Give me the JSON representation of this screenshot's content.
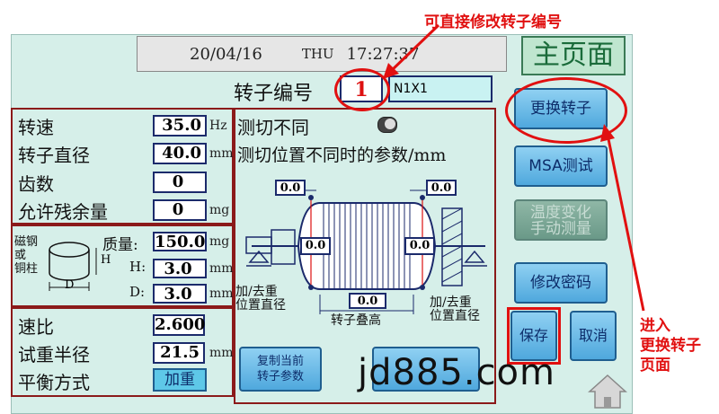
{
  "header": {
    "date": "20/04/16",
    "weekday": "THU",
    "time": "17:27:37",
    "page_title": "主页面"
  },
  "rotor": {
    "number_label": "转子编号",
    "number_value": "1",
    "name_value": "N1X1"
  },
  "params": {
    "speed": {
      "label": "转速",
      "value": "35.0",
      "unit": "Hz"
    },
    "diameter": {
      "label": "转子直径",
      "value": "40.0",
      "unit": "mm"
    },
    "teeth": {
      "label": "齿数",
      "value": "0"
    },
    "residual": {
      "label": "允许残余量",
      "value": "0",
      "unit": "mg"
    }
  },
  "weight": {
    "material_label_1": "磁钢",
    "material_label_2": "或",
    "material_label_3": "铜柱",
    "mass_label": "质量:",
    "mass_value": "150.0",
    "mass_unit": "mg",
    "h_label": "H:",
    "h_value": "3.0",
    "h_unit": "mm",
    "d_label": "D:",
    "d_value": "3.0",
    "d_unit": "mm",
    "h_tag": "H",
    "d_tag": "D"
  },
  "ratio": {
    "speed_ratio_label": "速比",
    "speed_ratio_value": "2.600",
    "trial_radius_label": "试重半径",
    "trial_radius_value": "21.5",
    "trial_radius_unit": "mm",
    "balance_label": "平衡方式",
    "balance_value": "加重"
  },
  "cut": {
    "label": "测切不同",
    "subtitle": "测切位置不同时的参数/mm",
    "val_top_left": "0.0",
    "val_top_right": "0.0",
    "val_mid_left": "0.0",
    "val_mid_right": "0.0",
    "val_bottom": "0.0",
    "left_caption_1": "加/去重",
    "left_caption_2": "位置直径",
    "right_caption_1": "加/去重",
    "right_caption_2": "位置直径",
    "bottom_caption": "转子叠高"
  },
  "buttons": {
    "copy_line1": "复制当前",
    "copy_line2": "转子参数",
    "replace_rotor": "更换转子",
    "msa_test": "MSA测试",
    "temp_line1": "温度变化",
    "temp_line2": "手动测量",
    "change_password": "修改密码",
    "save": "保存",
    "cancel": "取消"
  },
  "annotations": {
    "top": "可直接修改转子编号",
    "right_1": "进入",
    "right_2": "更换转子",
    "right_3": "页面"
  },
  "watermark": "jd885.com",
  "colors": {
    "annotation": "#e11010",
    "button_blue": "#4fa8dd",
    "screen_bg": "#d6efe9",
    "border_red": "#8b1a1a"
  }
}
